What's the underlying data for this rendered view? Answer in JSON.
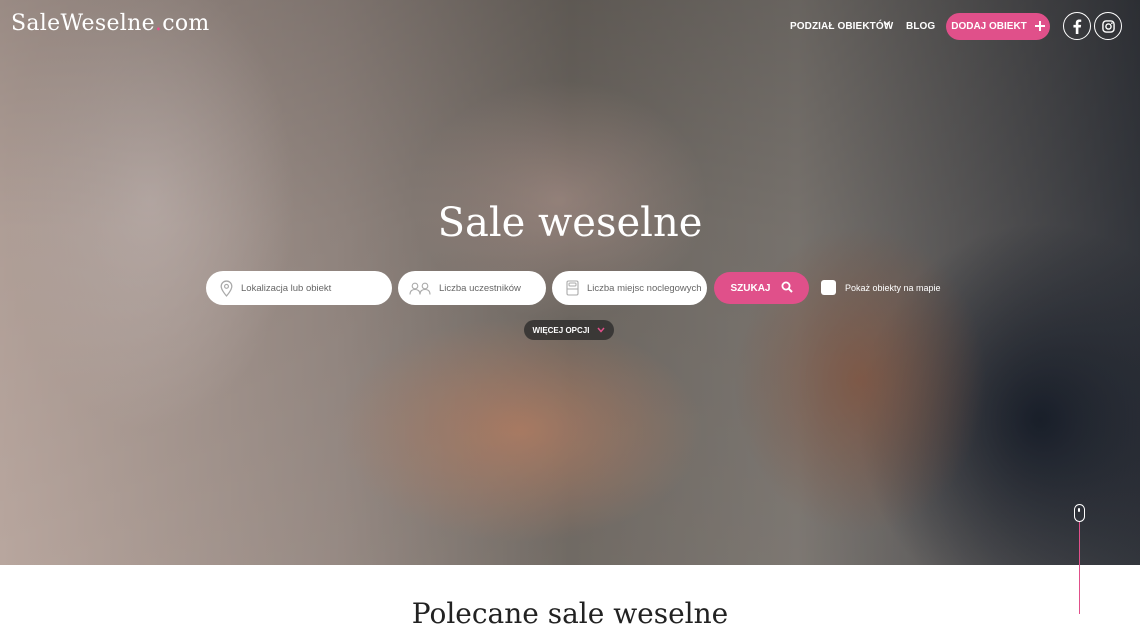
{
  "header": {
    "logo_main": "SaleWeselne",
    "logo_dot": ".",
    "logo_tld": "com",
    "nav": {
      "podzial": "PODZIAŁ OBIEKTÓW",
      "blog": "BLOG"
    },
    "add_button": "DODAJ OBIEKT"
  },
  "hero": {
    "title": "Sale weselne",
    "search": {
      "location_placeholder": "Lokalizacja lub obiekt",
      "guests_placeholder": "Liczba uczestników",
      "beds_placeholder": "Liczba miejsc noclegowych",
      "search_button": "SZUKAJ",
      "map_checkbox_label": "Pokaż obiekty na mapie",
      "more_options": "WIĘCEJ OPCJI"
    }
  },
  "featured": {
    "title": "Polecane sale weselne"
  },
  "colors": {
    "accent": "#e0508a",
    "white": "#ffffff"
  },
  "icons": [
    "location-pin-icon",
    "people-icon",
    "bed-icon",
    "search-icon",
    "facebook-icon",
    "instagram-icon",
    "chevron-down-icon",
    "plus-icon",
    "scroll-mouse-icon"
  ]
}
